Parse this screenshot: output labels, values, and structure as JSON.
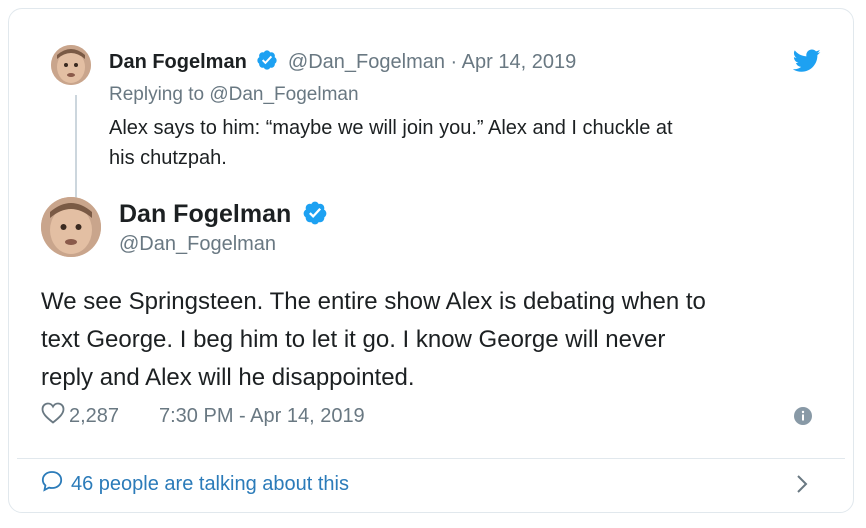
{
  "parent_tweet": {
    "author_name": "Dan Fogelman",
    "handle": "@Dan_Fogelman",
    "separator": " · ",
    "date": "Apr 14, 2019",
    "replying_to": "Replying to @Dan_Fogelman",
    "text_line1": "Alex says to him:  “maybe we will join you.”  Alex and I chuckle at",
    "text_line2": "his chutzpah."
  },
  "main_tweet": {
    "author_name": "Dan Fogelman",
    "handle": "@Dan_Fogelman",
    "text_line1": "We see Springsteen. The entire show Alex is debating when to",
    "text_line2": "text George. I beg him to let it go. I know George will never",
    "text_line3": "reply and Alex will he disappointed.",
    "likes": "2,287",
    "timestamp": "7:30 PM - Apr 14, 2019"
  },
  "footer": {
    "talking_label": "46 people are talking about this"
  },
  "icons": {
    "brand": "twitter-bird-icon",
    "verified": "verified-badge-icon",
    "like": "heart-icon",
    "info": "info-icon",
    "conversation": "speech-bubble-icon",
    "chevron": "chevron-right-icon"
  },
  "colors": {
    "twitter_blue": "#1da1f2",
    "verified_blue": "#1da1f2",
    "link_blue": "#2b7bb9",
    "muted": "#697882",
    "text": "#1c2022",
    "border": "#e1e8ed"
  }
}
